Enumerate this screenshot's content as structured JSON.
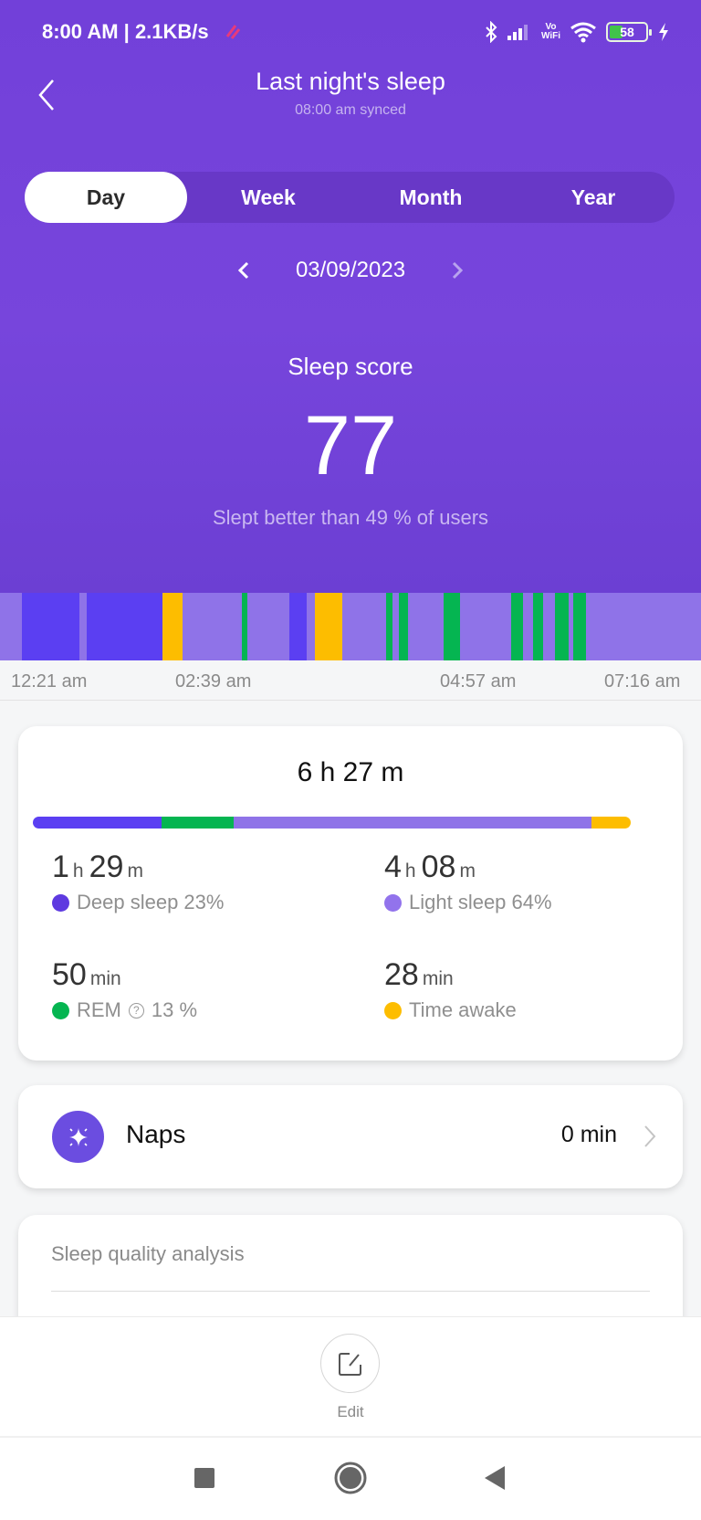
{
  "status_bar": {
    "time": "8:00 AM",
    "net_speed": "2.1KB/s",
    "vowifi_top": "Vo",
    "vowifi_bottom": "WiFi",
    "battery_level": "58",
    "icons": [
      "bluetooth-icon",
      "signal-icon",
      "vowifi-icon",
      "wifi-icon",
      "battery-icon",
      "charging-icon"
    ]
  },
  "header": {
    "title": "Last night's sleep",
    "subtitle": "08:00 am synced",
    "back_icon": "chevron-left-icon"
  },
  "tabs": [
    {
      "label": "Day",
      "active": true
    },
    {
      "label": "Week",
      "active": false
    },
    {
      "label": "Month",
      "active": false
    },
    {
      "label": "Year",
      "active": false
    }
  ],
  "date_nav": {
    "date": "03/09/2023",
    "prev_icon": "chevron-left-icon",
    "next_icon": "chevron-right-icon"
  },
  "score": {
    "label": "Sleep score",
    "value": "77",
    "comparison": "Slept better than 49 % of users"
  },
  "colors": {
    "deep": "#5b3ff2",
    "light": "#8f73e8",
    "rem": "#05b551",
    "awake": "#fdbd00",
    "accent": "#7442da"
  },
  "timeline": {
    "axis_labels": [
      "12:21 am",
      "02:39 am",
      "04:57 am",
      "07:16 am"
    ],
    "start": "12:21 am",
    "end": "07:16 am",
    "segments": [
      {
        "stage": "light",
        "from": 0.0,
        "to": 0.031
      },
      {
        "stage": "deep",
        "from": 0.031,
        "to": 0.113
      },
      {
        "stage": "light",
        "from": 0.113,
        "to": 0.124
      },
      {
        "stage": "deep",
        "from": 0.124,
        "to": 0.232
      },
      {
        "stage": "awake",
        "from": 0.232,
        "to": 0.26
      },
      {
        "stage": "light",
        "from": 0.26,
        "to": 0.345
      },
      {
        "stage": "rem",
        "from": 0.345,
        "to": 0.353
      },
      {
        "stage": "light",
        "from": 0.353,
        "to": 0.413
      },
      {
        "stage": "deep",
        "from": 0.413,
        "to": 0.438
      },
      {
        "stage": "light",
        "from": 0.438,
        "to": 0.449
      },
      {
        "stage": "awake",
        "from": 0.449,
        "to": 0.488
      },
      {
        "stage": "light",
        "from": 0.488,
        "to": 0.551
      },
      {
        "stage": "rem",
        "from": 0.551,
        "to": 0.56
      },
      {
        "stage": "light",
        "from": 0.56,
        "to": 0.569
      },
      {
        "stage": "rem",
        "from": 0.569,
        "to": 0.582
      },
      {
        "stage": "light",
        "from": 0.582,
        "to": 0.633
      },
      {
        "stage": "rem",
        "from": 0.633,
        "to": 0.656
      },
      {
        "stage": "light",
        "from": 0.656,
        "to": 0.729
      },
      {
        "stage": "rem",
        "from": 0.729,
        "to": 0.746
      },
      {
        "stage": "light",
        "from": 0.746,
        "to": 0.76
      },
      {
        "stage": "rem",
        "from": 0.76,
        "to": 0.775
      },
      {
        "stage": "light",
        "from": 0.775,
        "to": 0.792
      },
      {
        "stage": "rem",
        "from": 0.792,
        "to": 0.811
      },
      {
        "stage": "light",
        "from": 0.811,
        "to": 0.818
      },
      {
        "stage": "rem",
        "from": 0.818,
        "to": 0.836
      },
      {
        "stage": "light",
        "from": 0.836,
        "to": 1.0
      }
    ]
  },
  "summary": {
    "total": "6 h 27 m",
    "breakdown_bar": [
      {
        "stage": "deep",
        "fraction": 0.23
      },
      {
        "stage": "rem",
        "fraction": 0.13
      },
      {
        "stage": "light",
        "fraction": 0.64
      },
      {
        "stage": "awake",
        "fraction": 0.07
      }
    ],
    "stats": [
      {
        "id": "deep",
        "parts": [
          {
            "v": "1",
            "u": "h"
          },
          {
            "v": "29",
            "u": "m"
          }
        ],
        "label": "Deep sleep 23%"
      },
      {
        "id": "light",
        "parts": [
          {
            "v": "4",
            "u": "h"
          },
          {
            "v": "08",
            "u": "m"
          }
        ],
        "label": "Light sleep 64%"
      },
      {
        "id": "rem",
        "parts": [
          {
            "v": "50",
            "u": "min"
          }
        ],
        "label": "REM",
        "pct": "13 %"
      },
      {
        "id": "awake",
        "parts": [
          {
            "v": "28",
            "u": "min"
          }
        ],
        "label": "Time awake"
      }
    ]
  },
  "naps": {
    "label": "Naps",
    "value": "0 min"
  },
  "analysis": {
    "heading": "Sleep quality analysis"
  },
  "edit": {
    "label": "Edit"
  },
  "nav_bar": {
    "buttons": [
      "recents-button",
      "home-button",
      "back-button"
    ]
  }
}
